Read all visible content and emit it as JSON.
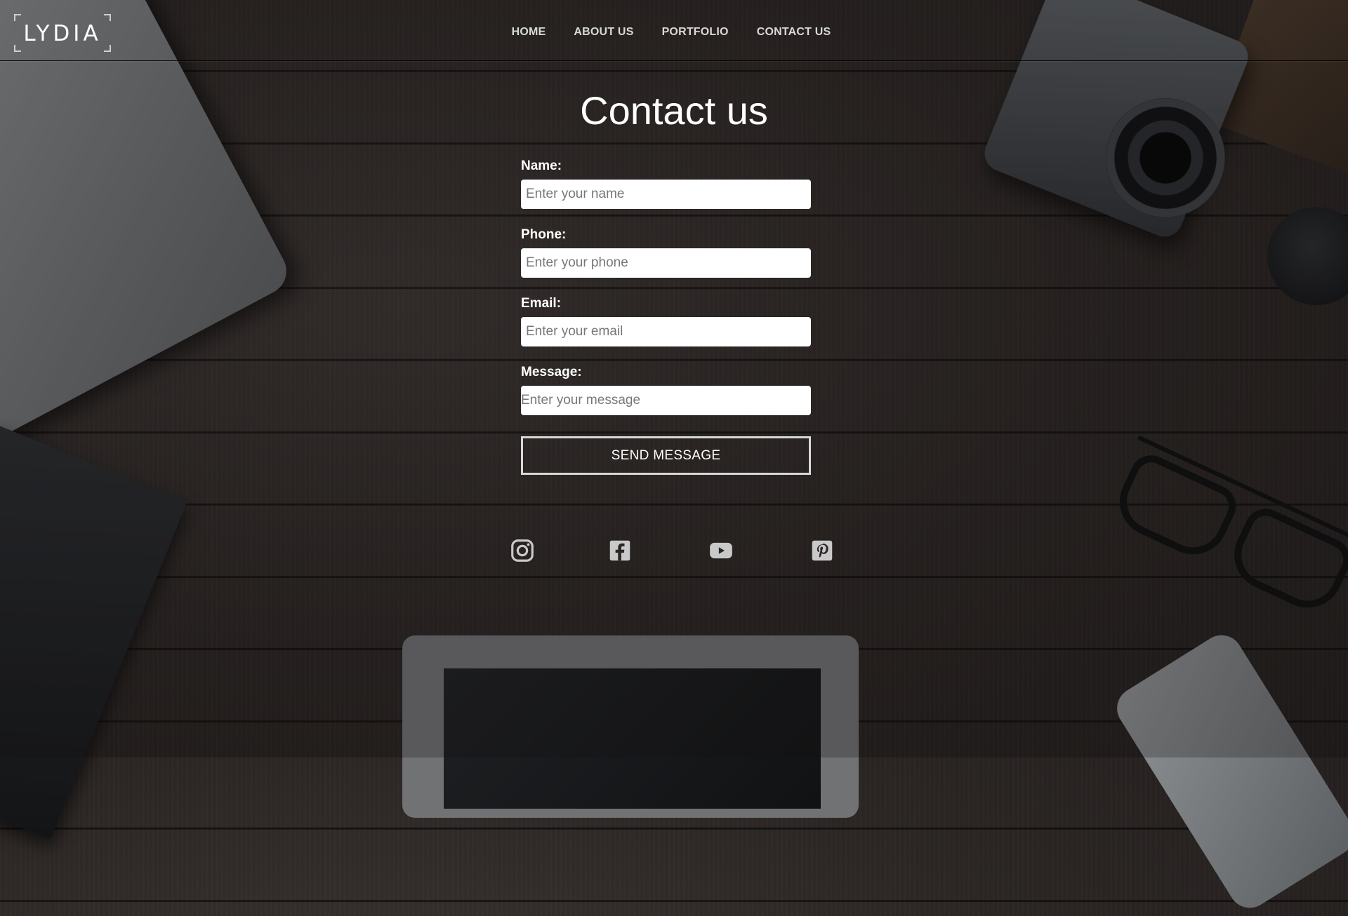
{
  "logo": {
    "text": "LYDIA"
  },
  "nav": {
    "items": [
      {
        "label": "HOME"
      },
      {
        "label": "ABOUT US"
      },
      {
        "label": "PORTFOLIO"
      },
      {
        "label": "CONTACT US"
      }
    ]
  },
  "page": {
    "title": "Contact us"
  },
  "form": {
    "name": {
      "label": "Name:",
      "placeholder": "Enter your name"
    },
    "phone": {
      "label": "Phone:",
      "placeholder": "Enter your phone"
    },
    "email": {
      "label": "Email:",
      "placeholder": "Enter your email"
    },
    "message": {
      "label": "Message:",
      "placeholder": "Enter your message"
    },
    "submit_label": "SEND MESSAGE"
  },
  "social": {
    "icons": [
      "instagram-icon",
      "facebook-icon",
      "youtube-icon",
      "pinterest-icon"
    ],
    "color": "#c9c9c9"
  },
  "colors": {
    "text": "#ffffff",
    "nav_text": "#d9d9d9",
    "button_border": "#d8d8d8",
    "background": "#2c2725"
  }
}
